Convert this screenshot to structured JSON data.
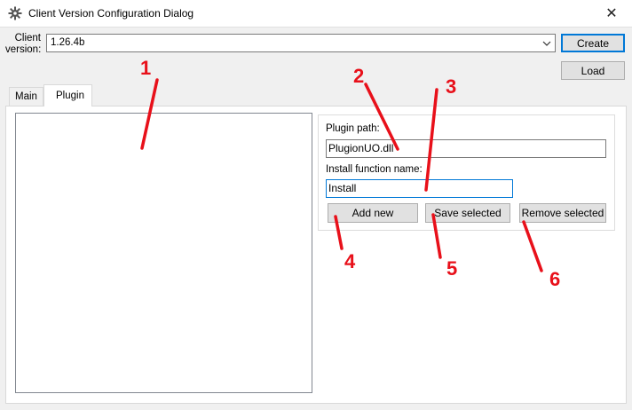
{
  "window": {
    "title": "Client Version Configuration Dialog",
    "close_glyph": "✕",
    "app_icon": "gear-app-icon",
    "close_icon": "close-icon"
  },
  "client_version": {
    "label": "Client version:",
    "value": "1.26.4b",
    "dropdown_icon": "chevron-down-icon"
  },
  "buttons": {
    "create": "Create",
    "load": "Load",
    "add_new": "Add new",
    "save_selected": "Save selected",
    "remove_selected": "Remove selected"
  },
  "tabs": [
    {
      "label": "Main",
      "active": false
    },
    {
      "label": "Plugin",
      "active": true
    }
  ],
  "plugin": {
    "list_items": [],
    "path_label": "Plugin path:",
    "path_value": "PlugionUO.dll",
    "install_label": "Install function name:",
    "install_value": "Install"
  },
  "annotations": {
    "color": "#e8101a",
    "numbers": [
      "1",
      "2",
      "3",
      "4",
      "5",
      "6"
    ]
  }
}
